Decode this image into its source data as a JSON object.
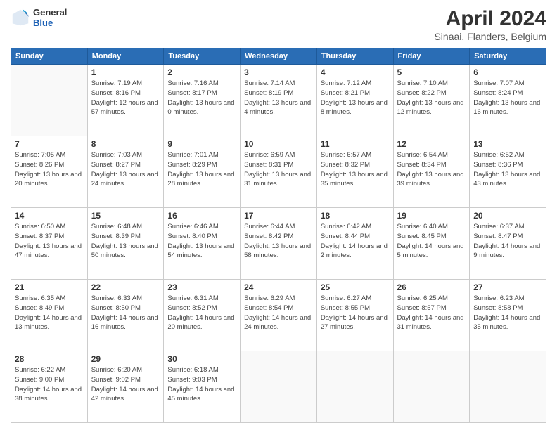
{
  "logo": {
    "general": "General",
    "blue": "Blue"
  },
  "header": {
    "title": "April 2024",
    "subtitle": "Sinaai, Flanders, Belgium"
  },
  "weekdays": [
    "Sunday",
    "Monday",
    "Tuesday",
    "Wednesday",
    "Thursday",
    "Friday",
    "Saturday"
  ],
  "weeks": [
    [
      {
        "day": "",
        "sunrise": "",
        "sunset": "",
        "daylight": ""
      },
      {
        "day": "1",
        "sunrise": "Sunrise: 7:19 AM",
        "sunset": "Sunset: 8:16 PM",
        "daylight": "Daylight: 12 hours and 57 minutes."
      },
      {
        "day": "2",
        "sunrise": "Sunrise: 7:16 AM",
        "sunset": "Sunset: 8:17 PM",
        "daylight": "Daylight: 13 hours and 0 minutes."
      },
      {
        "day": "3",
        "sunrise": "Sunrise: 7:14 AM",
        "sunset": "Sunset: 8:19 PM",
        "daylight": "Daylight: 13 hours and 4 minutes."
      },
      {
        "day": "4",
        "sunrise": "Sunrise: 7:12 AM",
        "sunset": "Sunset: 8:21 PM",
        "daylight": "Daylight: 13 hours and 8 minutes."
      },
      {
        "day": "5",
        "sunrise": "Sunrise: 7:10 AM",
        "sunset": "Sunset: 8:22 PM",
        "daylight": "Daylight: 13 hours and 12 minutes."
      },
      {
        "day": "6",
        "sunrise": "Sunrise: 7:07 AM",
        "sunset": "Sunset: 8:24 PM",
        "daylight": "Daylight: 13 hours and 16 minutes."
      }
    ],
    [
      {
        "day": "7",
        "sunrise": "Sunrise: 7:05 AM",
        "sunset": "Sunset: 8:26 PM",
        "daylight": "Daylight: 13 hours and 20 minutes."
      },
      {
        "day": "8",
        "sunrise": "Sunrise: 7:03 AM",
        "sunset": "Sunset: 8:27 PM",
        "daylight": "Daylight: 13 hours and 24 minutes."
      },
      {
        "day": "9",
        "sunrise": "Sunrise: 7:01 AM",
        "sunset": "Sunset: 8:29 PM",
        "daylight": "Daylight: 13 hours and 28 minutes."
      },
      {
        "day": "10",
        "sunrise": "Sunrise: 6:59 AM",
        "sunset": "Sunset: 8:31 PM",
        "daylight": "Daylight: 13 hours and 31 minutes."
      },
      {
        "day": "11",
        "sunrise": "Sunrise: 6:57 AM",
        "sunset": "Sunset: 8:32 PM",
        "daylight": "Daylight: 13 hours and 35 minutes."
      },
      {
        "day": "12",
        "sunrise": "Sunrise: 6:54 AM",
        "sunset": "Sunset: 8:34 PM",
        "daylight": "Daylight: 13 hours and 39 minutes."
      },
      {
        "day": "13",
        "sunrise": "Sunrise: 6:52 AM",
        "sunset": "Sunset: 8:36 PM",
        "daylight": "Daylight: 13 hours and 43 minutes."
      }
    ],
    [
      {
        "day": "14",
        "sunrise": "Sunrise: 6:50 AM",
        "sunset": "Sunset: 8:37 PM",
        "daylight": "Daylight: 13 hours and 47 minutes."
      },
      {
        "day": "15",
        "sunrise": "Sunrise: 6:48 AM",
        "sunset": "Sunset: 8:39 PM",
        "daylight": "Daylight: 13 hours and 50 minutes."
      },
      {
        "day": "16",
        "sunrise": "Sunrise: 6:46 AM",
        "sunset": "Sunset: 8:40 PM",
        "daylight": "Daylight: 13 hours and 54 minutes."
      },
      {
        "day": "17",
        "sunrise": "Sunrise: 6:44 AM",
        "sunset": "Sunset: 8:42 PM",
        "daylight": "Daylight: 13 hours and 58 minutes."
      },
      {
        "day": "18",
        "sunrise": "Sunrise: 6:42 AM",
        "sunset": "Sunset: 8:44 PM",
        "daylight": "Daylight: 14 hours and 2 minutes."
      },
      {
        "day": "19",
        "sunrise": "Sunrise: 6:40 AM",
        "sunset": "Sunset: 8:45 PM",
        "daylight": "Daylight: 14 hours and 5 minutes."
      },
      {
        "day": "20",
        "sunrise": "Sunrise: 6:37 AM",
        "sunset": "Sunset: 8:47 PM",
        "daylight": "Daylight: 14 hours and 9 minutes."
      }
    ],
    [
      {
        "day": "21",
        "sunrise": "Sunrise: 6:35 AM",
        "sunset": "Sunset: 8:49 PM",
        "daylight": "Daylight: 14 hours and 13 minutes."
      },
      {
        "day": "22",
        "sunrise": "Sunrise: 6:33 AM",
        "sunset": "Sunset: 8:50 PM",
        "daylight": "Daylight: 14 hours and 16 minutes."
      },
      {
        "day": "23",
        "sunrise": "Sunrise: 6:31 AM",
        "sunset": "Sunset: 8:52 PM",
        "daylight": "Daylight: 14 hours and 20 minutes."
      },
      {
        "day": "24",
        "sunrise": "Sunrise: 6:29 AM",
        "sunset": "Sunset: 8:54 PM",
        "daylight": "Daylight: 14 hours and 24 minutes."
      },
      {
        "day": "25",
        "sunrise": "Sunrise: 6:27 AM",
        "sunset": "Sunset: 8:55 PM",
        "daylight": "Daylight: 14 hours and 27 minutes."
      },
      {
        "day": "26",
        "sunrise": "Sunrise: 6:25 AM",
        "sunset": "Sunset: 8:57 PM",
        "daylight": "Daylight: 14 hours and 31 minutes."
      },
      {
        "day": "27",
        "sunrise": "Sunrise: 6:23 AM",
        "sunset": "Sunset: 8:58 PM",
        "daylight": "Daylight: 14 hours and 35 minutes."
      }
    ],
    [
      {
        "day": "28",
        "sunrise": "Sunrise: 6:22 AM",
        "sunset": "Sunset: 9:00 PM",
        "daylight": "Daylight: 14 hours and 38 minutes."
      },
      {
        "day": "29",
        "sunrise": "Sunrise: 6:20 AM",
        "sunset": "Sunset: 9:02 PM",
        "daylight": "Daylight: 14 hours and 42 minutes."
      },
      {
        "day": "30",
        "sunrise": "Sunrise: 6:18 AM",
        "sunset": "Sunset: 9:03 PM",
        "daylight": "Daylight: 14 hours and 45 minutes."
      },
      {
        "day": "",
        "sunrise": "",
        "sunset": "",
        "daylight": ""
      },
      {
        "day": "",
        "sunrise": "",
        "sunset": "",
        "daylight": ""
      },
      {
        "day": "",
        "sunrise": "",
        "sunset": "",
        "daylight": ""
      },
      {
        "day": "",
        "sunrise": "",
        "sunset": "",
        "daylight": ""
      }
    ]
  ]
}
